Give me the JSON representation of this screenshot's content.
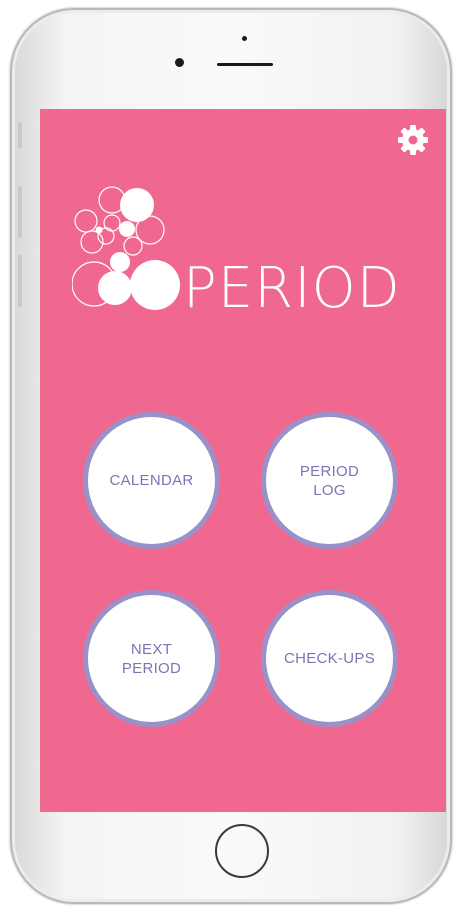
{
  "app": {
    "logo_text": "PERIOD"
  },
  "icons": {
    "settings": "gear-icon"
  },
  "colors": {
    "screen_background": "#f0688f",
    "button_border": "#9b91c9",
    "button_text": "#7d74b3"
  },
  "menu": {
    "calendar": "CALENDAR",
    "period_log": "PERIOD\nLOG",
    "next_period": "NEXT\nPERIOD",
    "check_ups": "CHECK-UPS"
  }
}
